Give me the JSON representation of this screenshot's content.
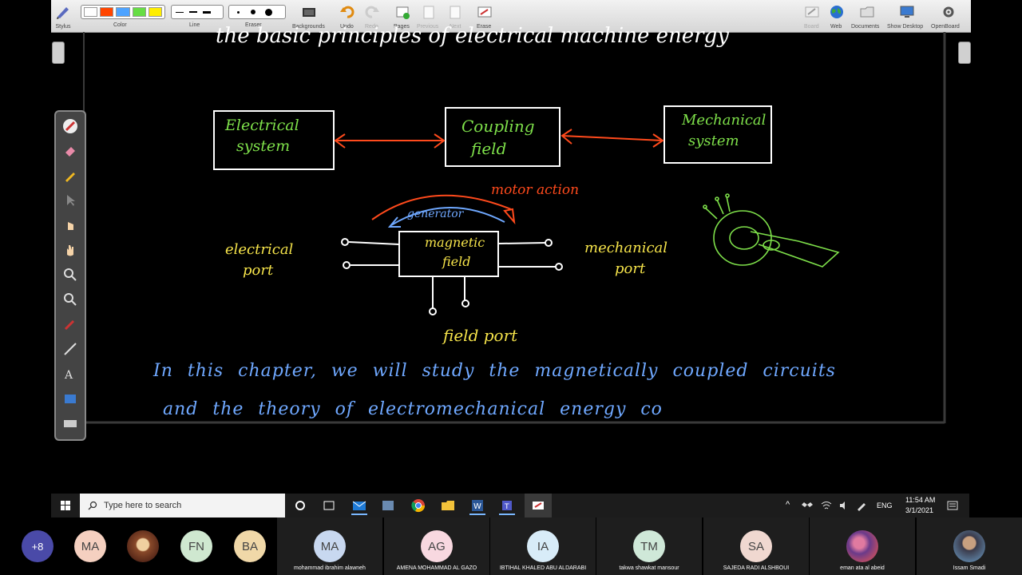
{
  "toolbar": {
    "groups": [
      {
        "id": "stylus",
        "label": "Stylus"
      },
      {
        "id": "color",
        "label": "Color"
      },
      {
        "id": "line",
        "label": "Line"
      },
      {
        "id": "eraser",
        "label": "Eraser"
      },
      {
        "id": "backgrounds",
        "label": "Backgrounds"
      },
      {
        "id": "undo",
        "label": "Undo"
      },
      {
        "id": "redo",
        "label": "Redo"
      },
      {
        "id": "pages",
        "label": "Pages"
      },
      {
        "id": "previous",
        "label": "Previous"
      },
      {
        "id": "next",
        "label": "Next"
      },
      {
        "id": "erase",
        "label": "Erase"
      },
      {
        "id": "board",
        "label": "Board"
      },
      {
        "id": "web",
        "label": "Web"
      },
      {
        "id": "documents",
        "label": "Documents"
      },
      {
        "id": "show_desktop",
        "label": "Show Desktop"
      },
      {
        "id": "openboard",
        "label": "OpenBoard"
      }
    ],
    "colors": [
      "#ffffff",
      "#ff4500",
      "#4da3ff",
      "#66dd44",
      "#ffee00"
    ]
  },
  "board": {
    "top_text": "the basic principles of electrical machine energy",
    "box_electrical": [
      "Electrical",
      "system"
    ],
    "box_coupling": [
      "Coupling",
      "field"
    ],
    "box_mechanical": [
      "Mechanical",
      "system"
    ],
    "motor_action": "motor action",
    "generator": "generator",
    "magnetic_field": [
      "magnetic",
      "field"
    ],
    "electrical_port": [
      "electrical",
      "port"
    ],
    "mechanical_port": [
      "mechanical",
      "port"
    ],
    "field_port": "field port",
    "line1": "In this chapter, we will study the magnetically coupled circuits",
    "line2": "and the theory of electromechanical energy co",
    "colors": {
      "white": "#ffffff",
      "red": "#ff4a1c",
      "blue": "#6fa8ff",
      "green": "#7ee04a",
      "yellow": "#f5e34a"
    }
  },
  "taskbar": {
    "search_placeholder": "Type here to search",
    "language": "ENG",
    "time": "11:54 AM",
    "date": "3/1/2021"
  },
  "participants": [
    {
      "initials": "+8",
      "name": "",
      "color": "#4a4aa8"
    },
    {
      "initials": "MA",
      "name": "",
      "color": "#f5d0c0"
    },
    {
      "initials": "",
      "name": "",
      "color": "#8a4a2a",
      "photo": true
    },
    {
      "initials": "FN",
      "name": "",
      "color": "#cfe8d0"
    },
    {
      "initials": "BA",
      "name": "",
      "color": "#f0d8a8"
    },
    {
      "initials": "MA",
      "name": "mohammad ibrahim alawneh",
      "color": "#c8d8f0"
    },
    {
      "initials": "AG",
      "name": "AMENA MOHAMMAD AL GAZO",
      "color": "#f8d8e0"
    },
    {
      "initials": "IA",
      "name": "IBTIHAL KHALED ABU ALDARABI",
      "color": "#d8ecf8"
    },
    {
      "initials": "TM",
      "name": "takwa shawkat mansour",
      "color": "#cfe8d8"
    },
    {
      "initials": "SA",
      "name": "SAJEDA RADI ALSHBOUI",
      "color": "#f0d8d0"
    },
    {
      "initials": "",
      "name": "eman ata al abeid",
      "color": "#b04a6a",
      "photo": true
    },
    {
      "initials": "",
      "name": "Issam Smadi",
      "color": "#5a7a9a",
      "photo": true
    }
  ]
}
